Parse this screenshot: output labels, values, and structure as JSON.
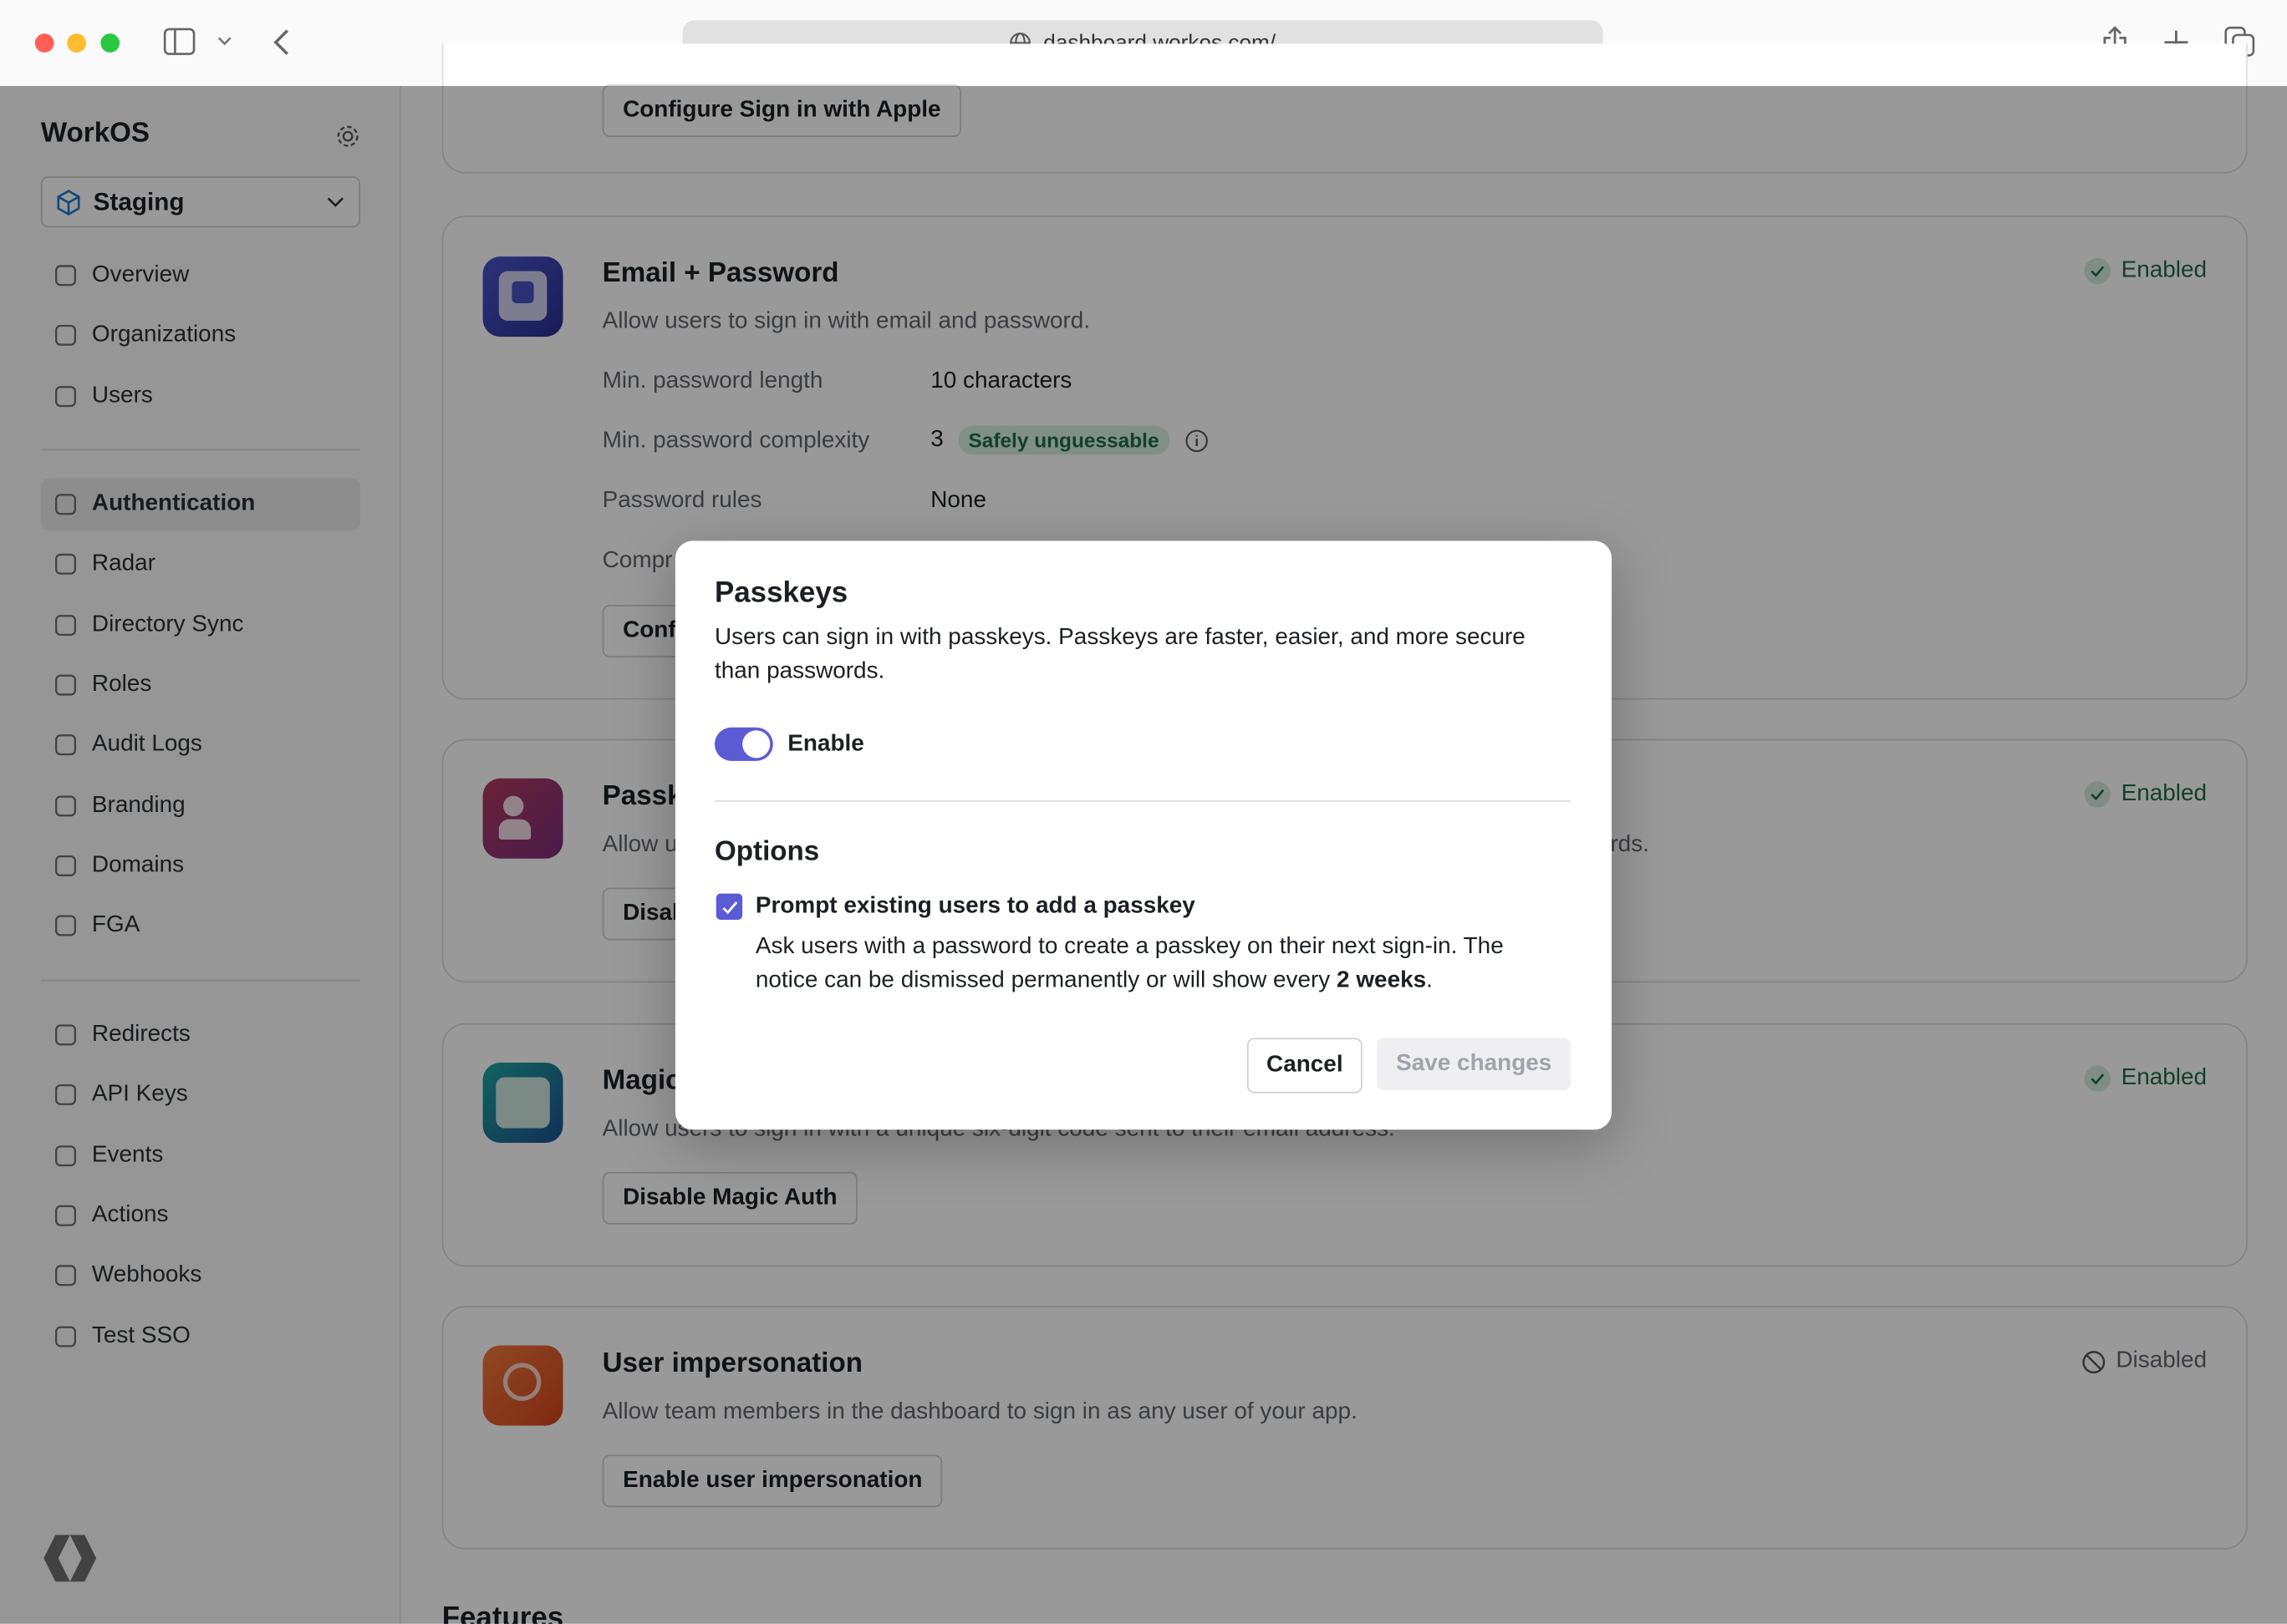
{
  "browser": {
    "url": "dashboard.workos.com/"
  },
  "sidebar": {
    "brand": "WorkOS",
    "environment": "Staging",
    "groups": [
      [
        {
          "label": "Overview",
          "icon": "grid-icon"
        },
        {
          "label": "Organizations",
          "icon": "layers-icon"
        },
        {
          "label": "Users",
          "icon": "user-icon"
        }
      ],
      [
        {
          "label": "Authentication",
          "icon": "auth-icon",
          "active": true
        },
        {
          "label": "Radar",
          "icon": "radar-icon"
        },
        {
          "label": "Directory Sync",
          "icon": "users-icon"
        },
        {
          "label": "Roles",
          "icon": "roles-icon"
        },
        {
          "label": "Audit Logs",
          "icon": "audit-icon"
        },
        {
          "label": "Branding",
          "icon": "brush-icon"
        },
        {
          "label": "Domains",
          "icon": "globe-icon"
        },
        {
          "label": "FGA",
          "icon": "fga-icon"
        }
      ],
      [
        {
          "label": "Redirects",
          "icon": "link-icon"
        },
        {
          "label": "API Keys",
          "icon": "key-icon"
        },
        {
          "label": "Events",
          "icon": "events-icon"
        },
        {
          "label": "Actions",
          "icon": "actions-icon"
        },
        {
          "label": "Webhooks",
          "icon": "webhook-icon"
        },
        {
          "label": "Test SSO",
          "icon": "bolt-icon"
        }
      ]
    ]
  },
  "cards": {
    "apple": {
      "button": "Configure Sign in with Apple"
    },
    "email": {
      "title": "Email + Password",
      "description": "Allow users to sign in with email and password.",
      "status": "Enabled",
      "rows": [
        {
          "label": "Min. password length",
          "value": "10 characters"
        },
        {
          "label": "Min. password complexity",
          "value": "3",
          "badge": "Safely unguessable"
        },
        {
          "label": "Password rules",
          "value": "None"
        },
        {
          "label": "Compr"
        }
      ],
      "button": "Conf"
    },
    "passkeys": {
      "title": "Passk",
      "description": "Allow u",
      "description_tail": "rds.",
      "status": "Enabled",
      "button": "Disal"
    },
    "magic": {
      "title": "Magic",
      "description": "Allow users to sign in with a unique six-digit code sent to their email address.",
      "status": "Enabled",
      "button": "Disable Magic Auth"
    },
    "impersonation": {
      "title": "User impersonation",
      "description": "Allow team members in the dashboard to sign in as any user of your app.",
      "status": "Disabled",
      "button": "Enable user impersonation"
    }
  },
  "features_heading": "Features",
  "modal": {
    "title": "Passkeys",
    "description": "Users can sign in with passkeys. Passkeys are faster, easier, and more secure than passwords.",
    "toggle_label": "Enable",
    "toggle_on": true,
    "options_title": "Options",
    "checkbox_label": "Prompt existing users to add a passkey",
    "checkbox_checked": true,
    "checkbox_desc": "Ask users with a password to create a passkey on their next sign-in. The notice can be dismissed permanently or will show every ",
    "checkbox_desc_bold": "2 weeks",
    "checkbox_desc_end": ".",
    "cancel": "Cancel",
    "save": "Save changes"
  },
  "colors": {
    "accent": "#5b5bd6",
    "enabled": "#1e6b4a"
  }
}
